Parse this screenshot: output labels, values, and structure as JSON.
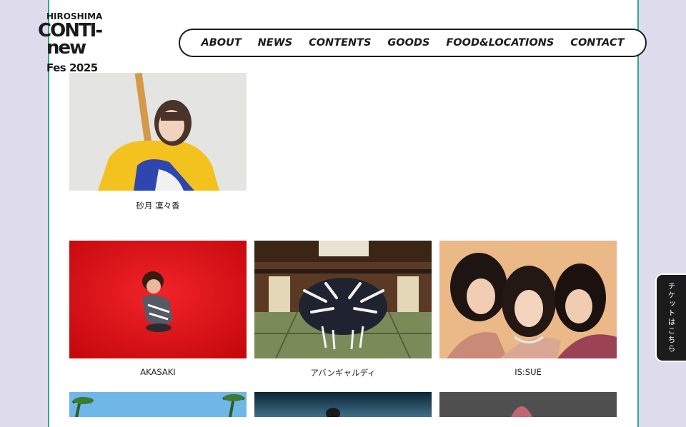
{
  "logo": {
    "line1": "HIROSHIMA",
    "line2": "CONTI-",
    "line3": "new",
    "line4": "Fes 2025"
  },
  "nav": {
    "items": [
      "ABOUT",
      "NEWS",
      "CONTENTS",
      "GOODS",
      "FOOD&LOCATIONS",
      "CONTACT"
    ]
  },
  "artists": [
    {
      "name": "砂月 凜々香"
    },
    {
      "name": "AKASAKI"
    },
    {
      "name": "アバンギャルディ"
    },
    {
      "name": "IS:SUE"
    }
  ],
  "ticket_button": {
    "label": "チケットはこちら"
  },
  "colors": {
    "background": "#dedcec",
    "frame": "#2ea98a",
    "text": "#1b1b1b"
  }
}
